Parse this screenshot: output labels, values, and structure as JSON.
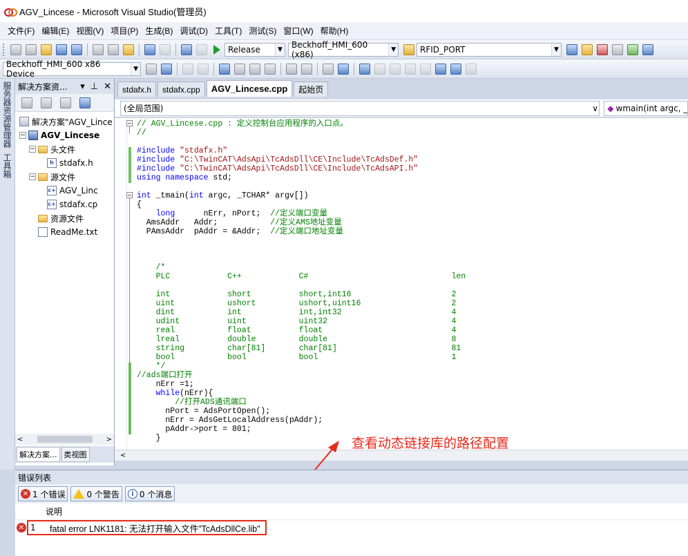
{
  "window": {
    "title": "AGV_Lincese - Microsoft Visual Studio(管理员)"
  },
  "menu": [
    "文件(F)",
    "编辑(E)",
    "视图(V)",
    "项目(P)",
    "生成(B)",
    "调试(D)",
    "工具(T)",
    "测试(S)",
    "窗口(W)",
    "帮助(H)"
  ],
  "toolbar": {
    "config": "Release",
    "platform": "Beckhoff_HMI_600 (x86)",
    "find_value": "RFID_PORT",
    "device": "Beckhoff_HMI_600 x86 Device"
  },
  "left_strip": {
    "tab1": "服务器资源管理器",
    "tab2": "工具箱"
  },
  "solution_explorer": {
    "title": "解决方案资...",
    "tree": [
      {
        "label": "解决方案\"AGV_Lince",
        "icon": "solution",
        "indent": 0
      },
      {
        "label": "AGV_Lincese",
        "icon": "project",
        "indent": 1,
        "bold": true
      },
      {
        "label": "头文件",
        "icon": "folder",
        "indent": 2
      },
      {
        "label": "stdafx.h",
        "icon": "h-file",
        "indent": 3
      },
      {
        "label": "源文件",
        "icon": "folder",
        "indent": 2
      },
      {
        "label": "AGV_Linc",
        "icon": "cpp-file",
        "indent": 3
      },
      {
        "label": "stdafx.cp",
        "icon": "cpp-file",
        "indent": 3
      },
      {
        "label": "资源文件",
        "icon": "folder",
        "indent": 2
      },
      {
        "label": "ReadMe.txt",
        "icon": "txt-file",
        "indent": 2
      }
    ],
    "bottom_tabs": [
      "解决方案...",
      "类视图"
    ]
  },
  "doc_tabs": [
    {
      "label": "stdafx.h",
      "active": false
    },
    {
      "label": "stdafx.cpp",
      "active": false
    },
    {
      "label": "AGV_Lincese.cpp",
      "active": true
    },
    {
      "label": "起始页",
      "active": false
    }
  ],
  "scope": {
    "left": "(全局范围)",
    "right": "wmain(int argc, _T"
  },
  "annotation": "查看动态链接库的路径配置",
  "error_list": {
    "title": "错误列表",
    "filters": {
      "errors": "1 个错误",
      "warnings": "0 个警告",
      "messages": "0 个消息"
    },
    "column": "说明",
    "rows": [
      {
        "num": "1",
        "desc": "fatal error LNK1181: 无法打开输入文件\"TcAdsDllCe.lib\""
      }
    ]
  },
  "colors": {
    "annotation": "#e8291a",
    "keyword": "#0000ff",
    "comment": "#008000",
    "string": "#a31515"
  }
}
